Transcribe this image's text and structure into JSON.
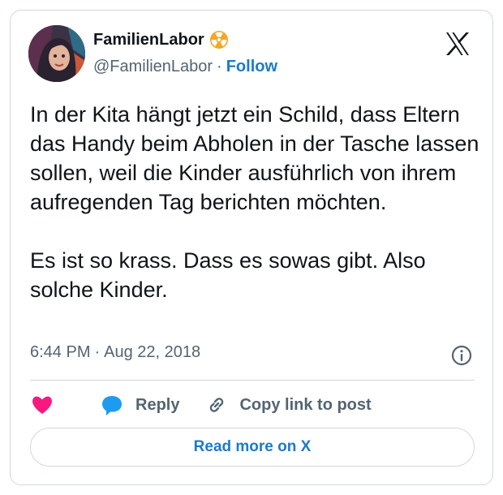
{
  "author": {
    "display_name": "FamilienLabor",
    "handle": "@FamilienLabor",
    "follow_label": "Follow",
    "separator": "·",
    "badge_icon": "radioactive-badge-icon"
  },
  "tweet": {
    "text": "In der Kita hängt jetzt ein Schild, dass Eltern das Handy beim Abholen in der Tasche lassen sollen, weil die Kinder ausführlich von ihrem aufregenden Tag berichten möchten.\n\nEs ist so krass. Dass es sowas gibt. Also solche Kinder.",
    "time": "6:44 PM",
    "separator": "·",
    "date": "Aug 22, 2018"
  },
  "actions": {
    "like_icon": "heart-icon",
    "reply_label": "Reply",
    "copy_link_label": "Copy link to post"
  },
  "footer": {
    "read_more_label": "Read more on X"
  },
  "colors": {
    "accent": "#1d7bc7",
    "like": "#f91880",
    "muted": "#536471",
    "text": "#0f1419",
    "border": "#cfd9de",
    "badge": "#f5a623"
  }
}
